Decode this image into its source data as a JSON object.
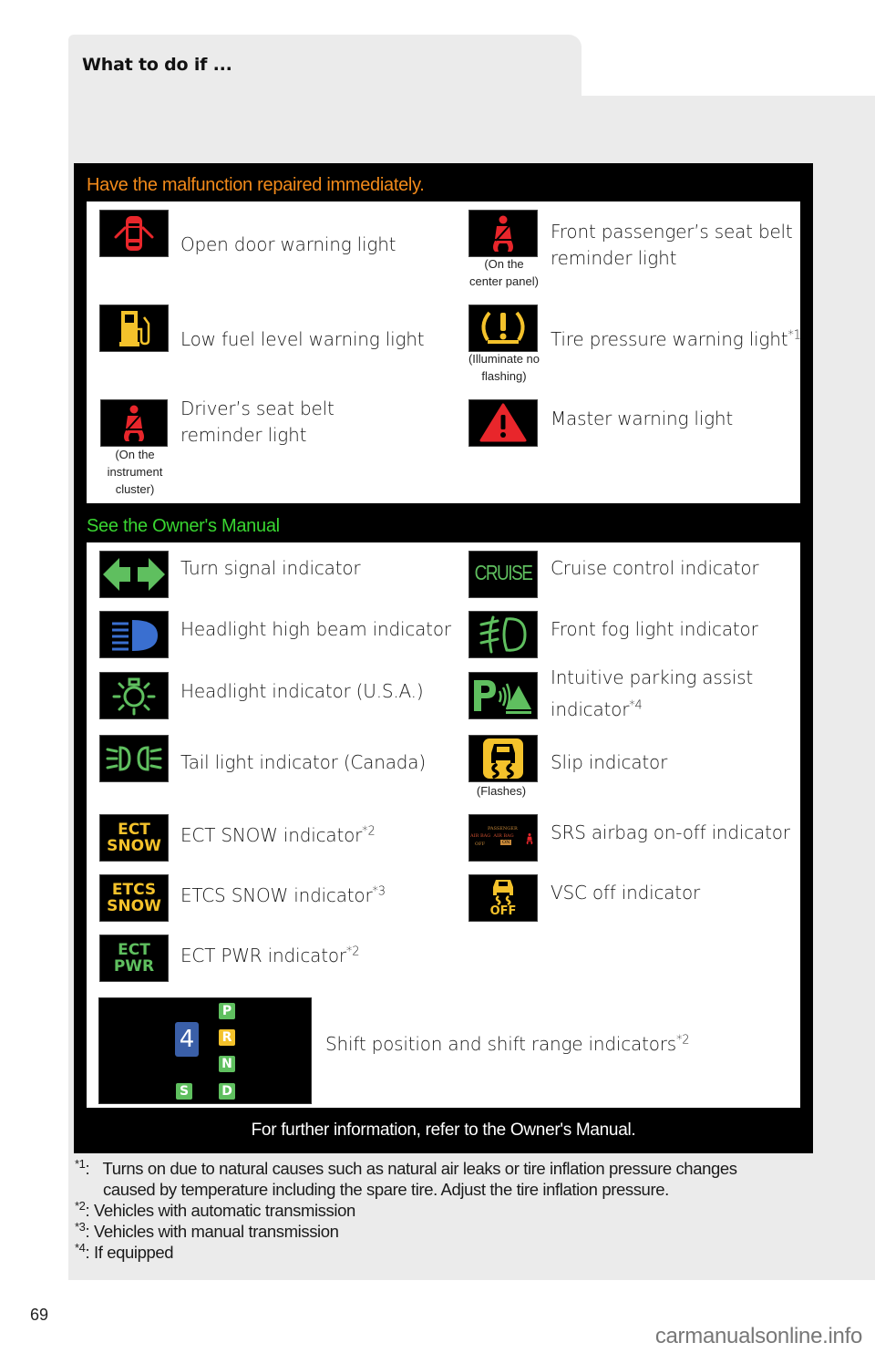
{
  "header": {
    "title": "What to do if ..."
  },
  "section_repair": {
    "heading": "Have the malfunction repaired immediately.",
    "heading_color": "#f28a1a",
    "items": [
      {
        "icon": "open-door-icon",
        "label": "Open door warning light",
        "color": "#e8262b"
      },
      {
        "icon": "passenger-seatbelt-icon",
        "label_line1": "Front passenger’s seat belt",
        "label_line2": "reminder light",
        "note_line1": "(On the",
        "note_line2": "center panel)",
        "color": "#e8262b"
      },
      {
        "icon": "fuel-pump-icon",
        "label": "Low fuel level warning light",
        "color": "#f4c22b"
      },
      {
        "icon": "tire-pressure-icon",
        "label": "Tire pressure warning light",
        "sup": "*1",
        "note_line1": "(Illuminate no",
        "note_line2": "flashing)",
        "color": "#f4c22b"
      },
      {
        "icon": "driver-seatbelt-icon",
        "label_line1": "Driver’s seat belt",
        "label_line2": "reminder light",
        "note_line1": "(On the",
        "note_line2": "instrument",
        "note_line3": "cluster)",
        "color": "#e8262b"
      },
      {
        "icon": "master-warning-icon",
        "label": "Master warning light",
        "color": "#e8262b"
      }
    ]
  },
  "section_manual": {
    "heading": "See the Owner's Manual",
    "heading_color": "#39d631",
    "items": [
      {
        "icon": "turn-signal-icon",
        "label": "Turn signal indicator",
        "color": "#5fbf5f"
      },
      {
        "icon": "cruise-icon",
        "label": "Cruise control indicator",
        "icon_text": "CRUISE",
        "color": "#5fbf5f"
      },
      {
        "icon": "high-beam-icon",
        "label": "Headlight high beam indicator",
        "color": "#3a6fd0"
      },
      {
        "icon": "fog-light-icon",
        "label": "Front fog light indicator",
        "color": "#5fbf5f"
      },
      {
        "icon": "headlight-icon",
        "label": "Headlight indicator (U.S.A.)",
        "color": "#5fbf5f"
      },
      {
        "icon": "parking-assist-icon",
        "label_line1": "Intuitive parking assist",
        "label_line2": "indicator",
        "sup": "*4",
        "color": "#5fbf5f"
      },
      {
        "icon": "tail-light-icon",
        "label": "Tail light indicator (Canada)",
        "color": "#5fbf5f"
      },
      {
        "icon": "slip-icon",
        "label": "Slip indicator",
        "note_line1": "(Flashes)",
        "color": "#f4c22b"
      },
      {
        "icon": "ect-snow-icon",
        "label": "ECT SNOW indicator",
        "sup": "*2",
        "icon_line1": "ECT",
        "icon_line2": "SNOW",
        "color": "#f4c22b"
      },
      {
        "icon": "srs-airbag-icon",
        "label": "SRS airbag on-off indicator",
        "icon_line1": "PASSENGER",
        "icon_line2": "AIR BAG  AIR BAG",
        "icon_line3": "OFF",
        "icon_on": "ON",
        "color": "#e8262b"
      },
      {
        "icon": "etcs-snow-icon",
        "label": "ETCS SNOW indicator",
        "sup": "*3",
        "icon_line1": "ETCS",
        "icon_line2": "SNOW",
        "color": "#f4c22b"
      },
      {
        "icon": "vsc-off-icon",
        "label": "VSC off indicator",
        "icon_text": "OFF",
        "color": "#f4c22b"
      },
      {
        "icon": "ect-pwr-icon",
        "label": "ECT PWR indicator",
        "sup": "*2",
        "icon_line1": "ECT",
        "icon_line2": "PWR",
        "color": "#5fbf5f"
      }
    ],
    "shift": {
      "label": "Shift position and shift range indicators",
      "sup": "*2",
      "gear_display": "4",
      "positions": [
        "P",
        "R",
        "N",
        "D"
      ],
      "range": "S",
      "active_position": "R",
      "gear_color": "#3a5fa8",
      "position_color": "#5fbf5f",
      "active_color": "#f4c22b"
    }
  },
  "footer_message": "For further information, refer to the Owner's Manual.",
  "footnotes": [
    {
      "mark": "*1",
      "sep": ":",
      "line1": "Turns on due to natural causes such as natural air leaks or tire inflation pressure changes",
      "line2": "caused by temperature including the spare tire. Adjust the tire inflation pressure."
    },
    {
      "mark": "*2",
      "sep": ":",
      "text": "Vehicles with automatic transmission"
    },
    {
      "mark": "*3",
      "sep": ":",
      "text": "Vehicles with manual transmission"
    },
    {
      "mark": "*4",
      "sep": ":",
      "text": "If equipped"
    }
  ],
  "page_number": "69",
  "watermark": "carmanualsonline.info"
}
